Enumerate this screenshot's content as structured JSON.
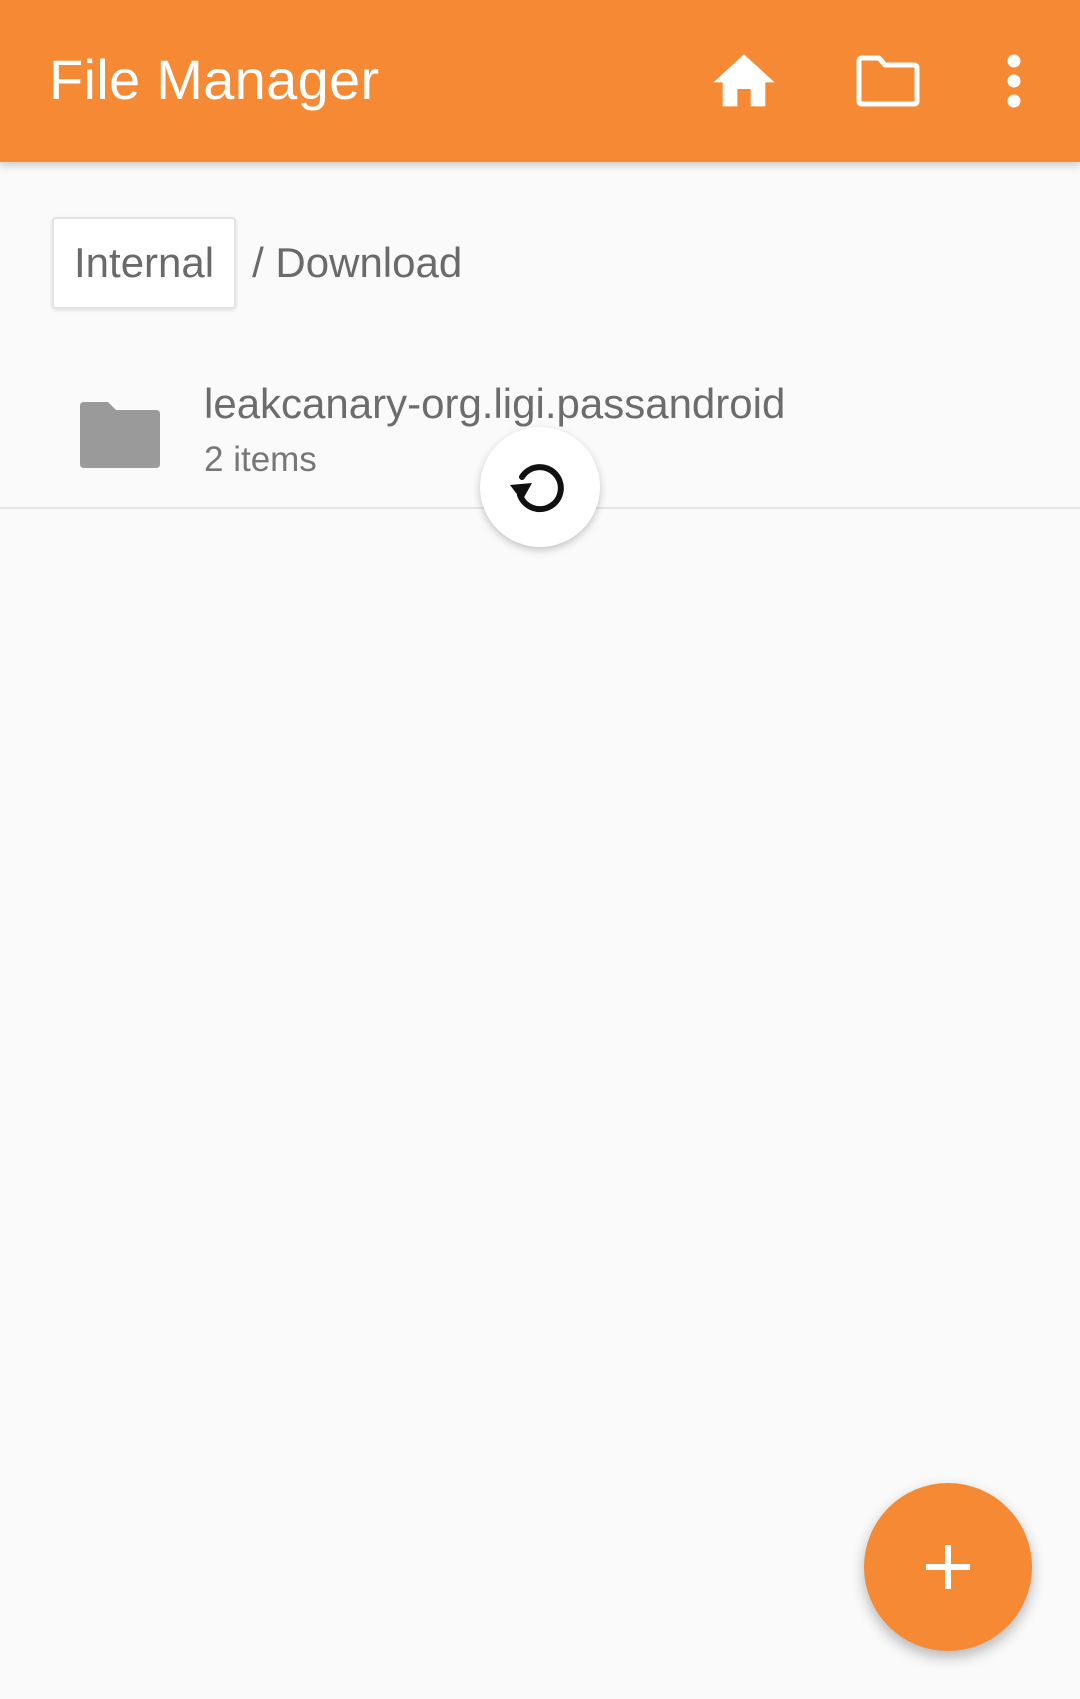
{
  "colors": {
    "toolbar": "#f68934",
    "fab": "#f68934",
    "background": "#fafafa",
    "folder_icon": "#9a9a9a",
    "text_secondary": "#6c6c6c"
  },
  "toolbar": {
    "title": "File Manager",
    "actions": [
      {
        "icon": "home-icon"
      },
      {
        "icon": "folder-outline-icon"
      },
      {
        "icon": "more-vert-icon"
      }
    ]
  },
  "breadcrumb": {
    "root": "Internal",
    "path": "/ Download"
  },
  "files": [
    {
      "icon": "folder-icon",
      "name": "leakcanary-org.ligi.passandroid",
      "meta": "2 items"
    }
  ],
  "refresh": {
    "icon": "refresh-icon"
  },
  "fab": {
    "icon": "plus-icon"
  }
}
